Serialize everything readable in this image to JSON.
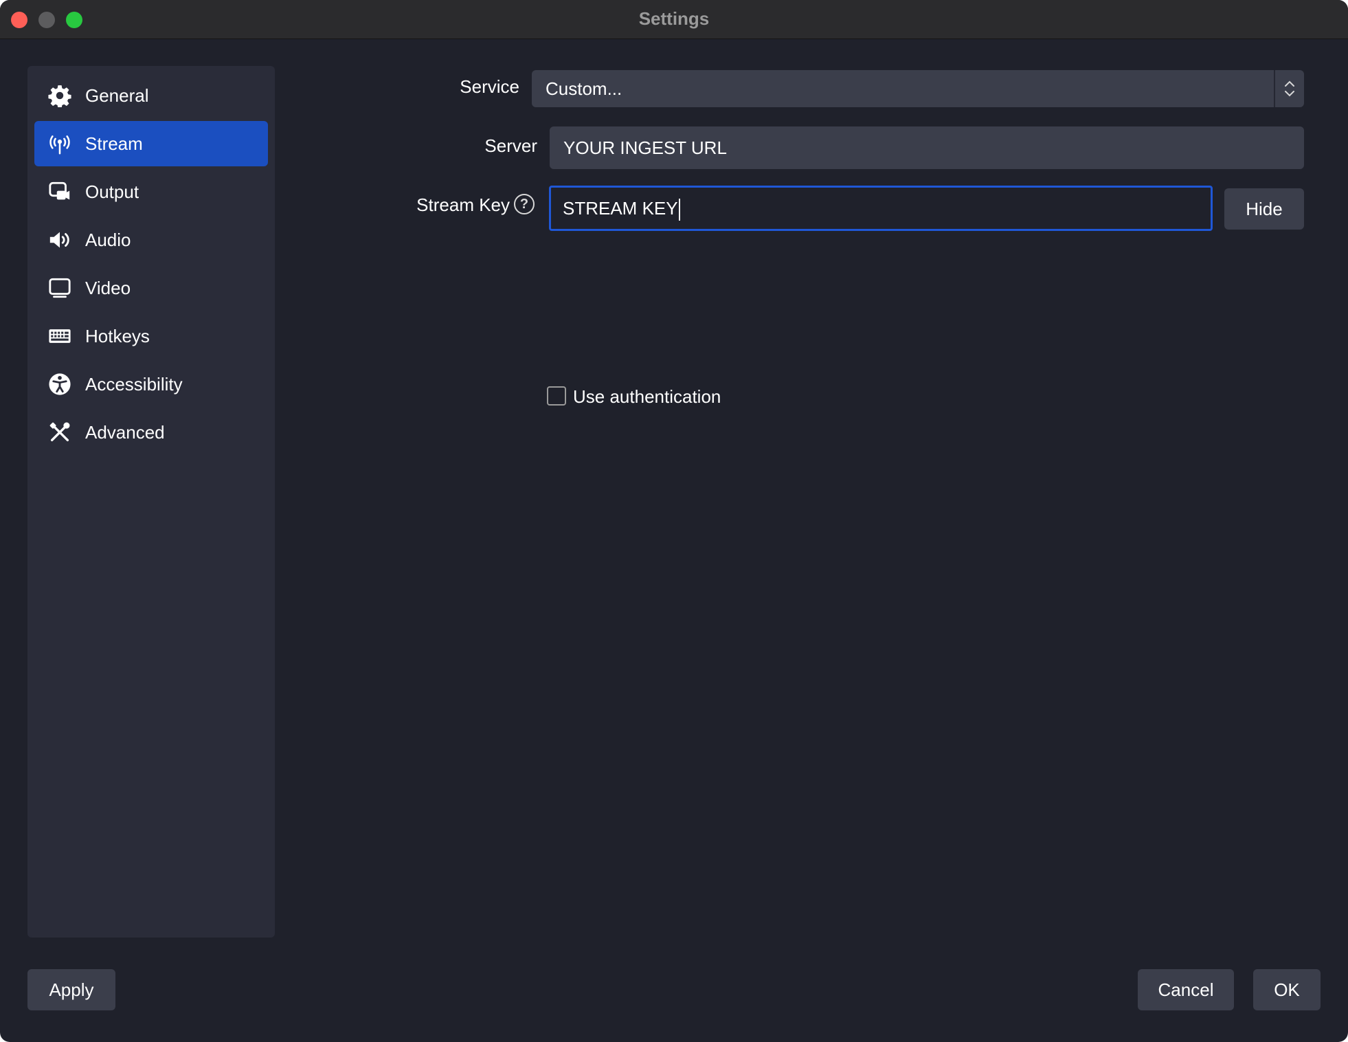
{
  "window": {
    "title": "Settings"
  },
  "sidebar": {
    "items": [
      {
        "label": "General",
        "icon": "gear-icon",
        "active": false
      },
      {
        "label": "Stream",
        "icon": "antenna-icon",
        "active": true
      },
      {
        "label": "Output",
        "icon": "output-icon",
        "active": false
      },
      {
        "label": "Audio",
        "icon": "speaker-icon",
        "active": false
      },
      {
        "label": "Video",
        "icon": "monitor-icon",
        "active": false
      },
      {
        "label": "Hotkeys",
        "icon": "keyboard-icon",
        "active": false
      },
      {
        "label": "Accessibility",
        "icon": "accessibility-icon",
        "active": false
      },
      {
        "label": "Advanced",
        "icon": "tools-icon",
        "active": false
      }
    ]
  },
  "stream": {
    "service_label": "Service",
    "service_value": "Custom...",
    "server_label": "Server",
    "server_value": "YOUR INGEST URL",
    "key_label": "Stream Key",
    "key_value": "STREAM KEY",
    "hide_label": "Hide",
    "auth_label": "Use authentication",
    "auth_checked": false
  },
  "footer": {
    "apply": "Apply",
    "cancel": "Cancel",
    "ok": "OK"
  },
  "colors": {
    "accent": "#1b4fc0",
    "background": "#1f212b",
    "sidebar": "#2a2c39",
    "field": "#3b3e4b"
  }
}
